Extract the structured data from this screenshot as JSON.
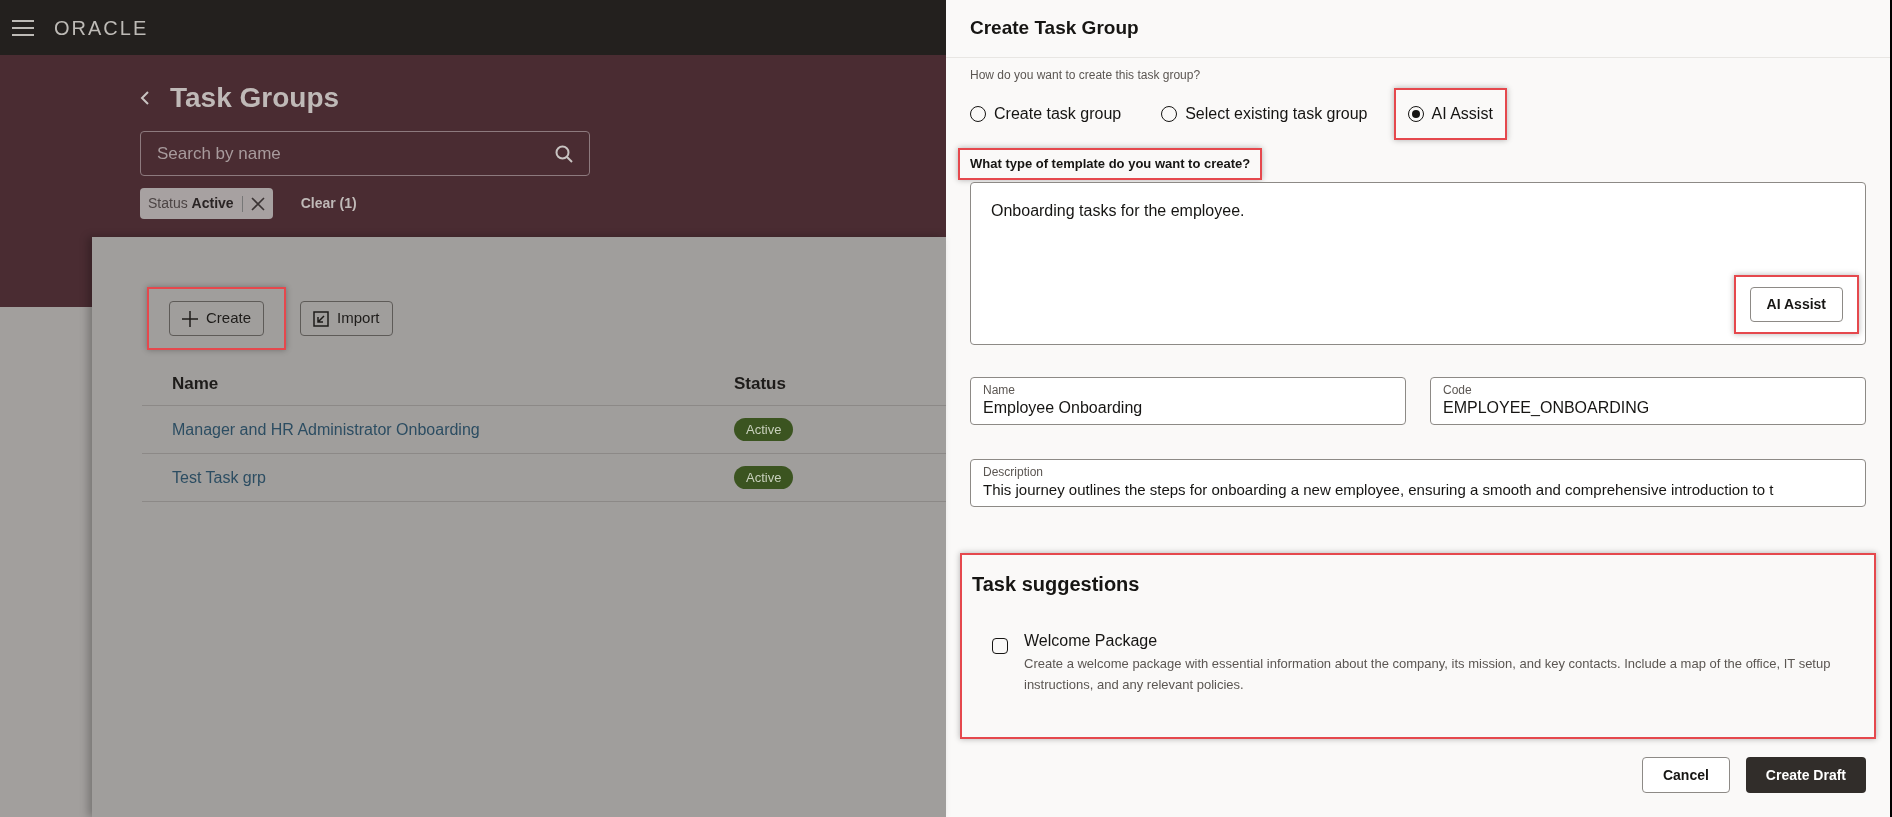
{
  "top_bar": {
    "logo": "ORACLE"
  },
  "page": {
    "title": "Task Groups",
    "search": {
      "placeholder": "Search by name"
    },
    "filter_chip": {
      "label": "Status",
      "value": "Active"
    },
    "clear_link": "Clear (1)",
    "toolbar": [
      {
        "label": "Create",
        "kind": "add",
        "highlighted": true
      },
      {
        "label": "Import",
        "kind": "import",
        "highlighted": false
      }
    ],
    "table": {
      "columns": [
        "Name",
        "Status"
      ],
      "rows": [
        {
          "name": "Manager and HR Administrator Onboarding",
          "status": "Active"
        },
        {
          "name": "Test Task grp",
          "status": "Active"
        }
      ]
    }
  },
  "drawer": {
    "title": "Create Task Group",
    "question": "How do you want to create this task group?",
    "options": [
      {
        "label": "Create task group",
        "selected": false,
        "highlighted": false
      },
      {
        "label": "Select existing task group",
        "selected": false,
        "highlighted": false
      },
      {
        "label": "AI Assist",
        "selected": true,
        "highlighted": true
      }
    ],
    "prompt": {
      "label": "What type of template do you want to create?",
      "highlighted": true,
      "value": "Onboarding tasks for the employee.",
      "button": {
        "label": "AI Assist",
        "highlighted": true
      }
    },
    "fields": [
      {
        "label": "Name",
        "value": "Employee Onboarding"
      },
      {
        "label": "Code",
        "value": "EMPLOYEE_ONBOARDING"
      },
      {
        "label": "Description",
        "value": "This journey outlines the steps for onboarding a new employee, ensuring a smooth and comprehensive introduction to t"
      }
    ],
    "suggestions": {
      "title": "Task suggestions",
      "highlighted": true,
      "items": [
        {
          "title": "Welcome Package",
          "description": "Create a welcome package with essential information about the company, its mission, and key contacts. Include a map of the office, IT setup instructions, and any relevant policies.",
          "checked": false
        }
      ]
    },
    "buttons": [
      {
        "label": "Cancel",
        "kind": "secondary"
      },
      {
        "label": "Create Draft",
        "kind": "primary"
      }
    ]
  }
}
